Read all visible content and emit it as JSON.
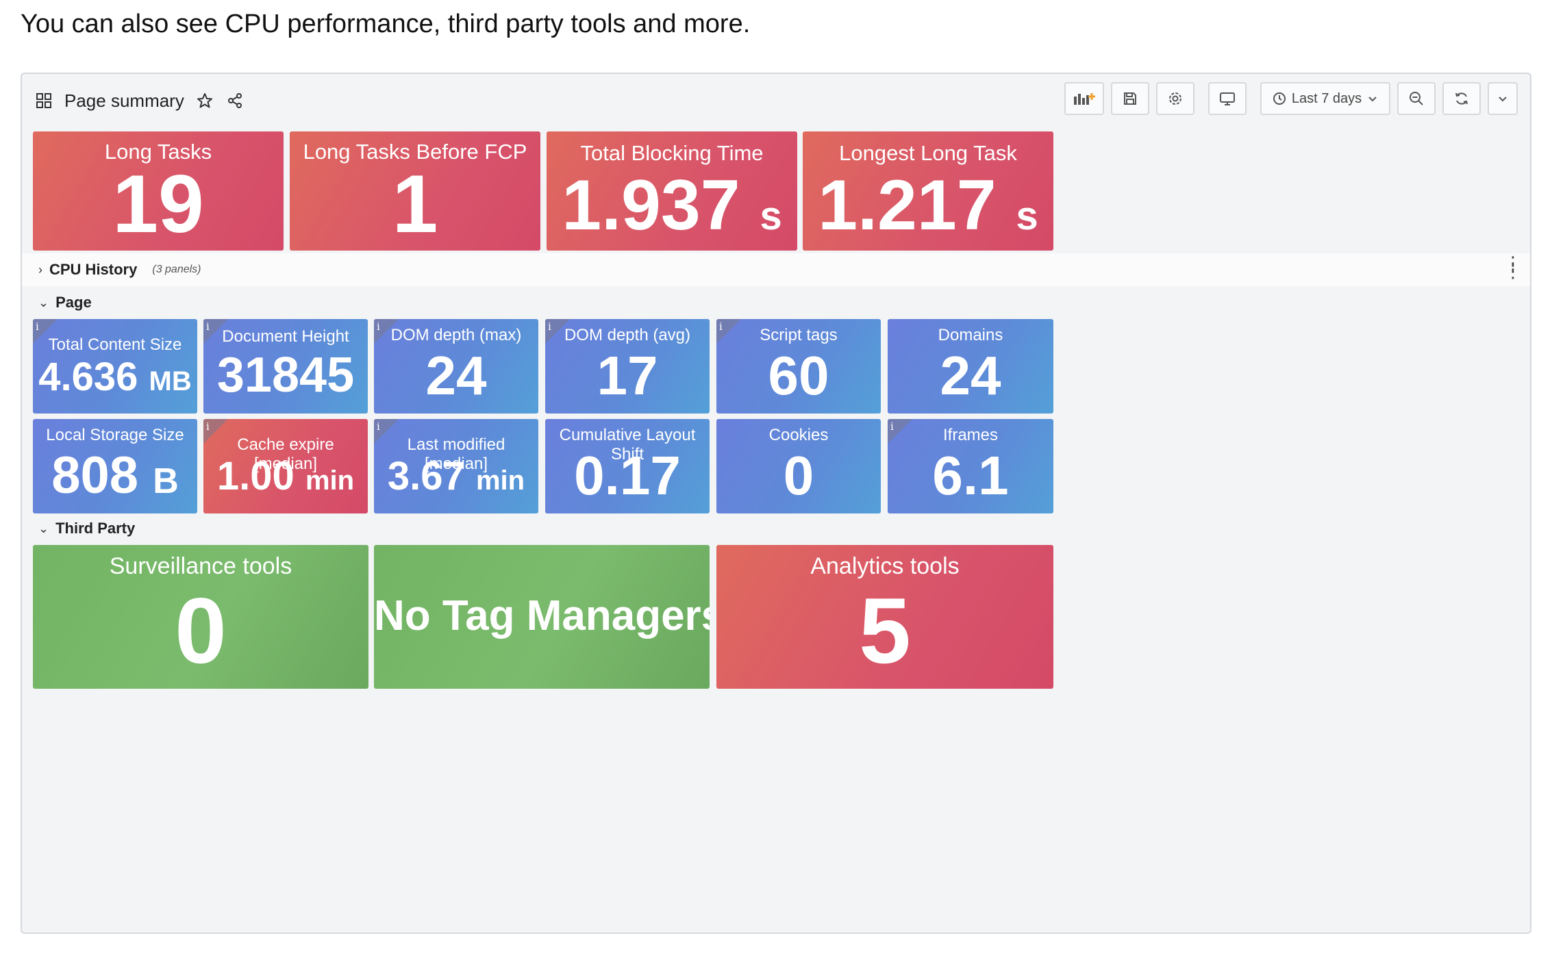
{
  "caption": "You can also see CPU performance, third party tools and more.",
  "dashboard": {
    "title": "Page summary",
    "time_range": "Last 7 days"
  },
  "summary_panels": [
    {
      "title": "Long Tasks",
      "value": "19",
      "unit": ""
    },
    {
      "title": "Long Tasks Before FCP",
      "value": "1",
      "unit": ""
    },
    {
      "title": "Total Blocking Time",
      "value": "1.937",
      "unit": "s"
    },
    {
      "title": "Longest Long Task",
      "value": "1.217",
      "unit": "s"
    }
  ],
  "rows": {
    "cpu": {
      "label": "CPU History",
      "sub": "(3 panels)"
    },
    "page": {
      "label": "Page"
    },
    "third_party": {
      "label": "Third Party"
    }
  },
  "page_panels": [
    {
      "title": "Total Content Size",
      "value": "4.636",
      "unit": "MB"
    },
    {
      "title": "Document Height",
      "value": "31845",
      "unit": ""
    },
    {
      "title": "DOM depth (max)",
      "value": "24",
      "unit": ""
    },
    {
      "title": "DOM depth (avg)",
      "value": "17",
      "unit": ""
    },
    {
      "title": "Script tags",
      "value": "60",
      "unit": ""
    },
    {
      "title": "Domains",
      "value": "24",
      "unit": ""
    },
    {
      "title": "Local Storage Size",
      "value": "808",
      "unit": "B"
    },
    {
      "title": "Cache expire [median]",
      "value": "1.00",
      "unit": "min"
    },
    {
      "title": "Last modified [median]",
      "value": "3.67",
      "unit": "min"
    },
    {
      "title": "Cumulative Layout Shift",
      "value": "0.17",
      "unit": ""
    },
    {
      "title": "Cookies",
      "value": "0",
      "unit": ""
    },
    {
      "title": "Iframes",
      "value": "6.1",
      "unit": ""
    }
  ],
  "third_party_panels": [
    {
      "title": "Surveillance tools",
      "value": "0"
    },
    {
      "title": "",
      "value": "No Tag Managers"
    },
    {
      "title": "Analytics tools",
      "value": "5"
    }
  ],
  "colors": {
    "red": "#d8546a",
    "blue": "#5e8ad8",
    "green": "#7bbb6d"
  }
}
